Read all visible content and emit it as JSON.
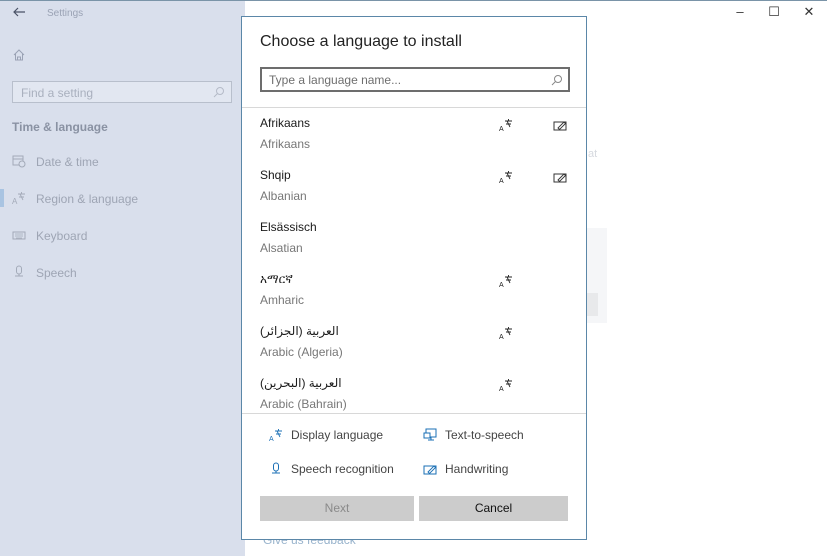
{
  "window": {
    "title": "Settings",
    "controls": {
      "minimize": "–",
      "maximize": "☐",
      "close": "✕"
    }
  },
  "sidebar": {
    "search_placeholder": "Find a setting",
    "section_title": "Time & language",
    "items": [
      {
        "label": "Date & time",
        "icon": "calendar-clock-icon",
        "active": false
      },
      {
        "label": "Region & language",
        "icon": "language-icon",
        "active": true
      },
      {
        "label": "Keyboard",
        "icon": "keyboard-icon",
        "active": false
      },
      {
        "label": "Speech",
        "icon": "microphone-icon",
        "active": false
      }
    ]
  },
  "background": {
    "faded_fragment": "at",
    "feedback_link": "Give us feedback"
  },
  "dialog": {
    "title": "Choose a language to install",
    "search_placeholder": "Type a language name...",
    "languages": [
      {
        "native": "Afrikaans",
        "english": "Afrikaans",
        "display_language": true,
        "handwriting": true
      },
      {
        "native": "Shqip",
        "english": "Albanian",
        "display_language": true,
        "handwriting": true
      },
      {
        "native": "Elsässisch",
        "english": "Alsatian",
        "display_language": false,
        "handwriting": false
      },
      {
        "native": "አማርኛ",
        "english": "Amharic",
        "display_language": true,
        "handwriting": false
      },
      {
        "native": "العربية (الجزائر)",
        "english": "Arabic (Algeria)",
        "display_language": true,
        "handwriting": false
      },
      {
        "native": "العربية (البحرين)",
        "english": "Arabic (Bahrain)",
        "display_language": true,
        "handwriting": false
      }
    ],
    "legend": {
      "display_language": "Display language",
      "text_to_speech": "Text-to-speech",
      "speech_recognition": "Speech recognition",
      "handwriting": "Handwriting"
    },
    "buttons": {
      "next": "Next",
      "cancel": "Cancel"
    },
    "accent_color": "#1a6fb5"
  }
}
